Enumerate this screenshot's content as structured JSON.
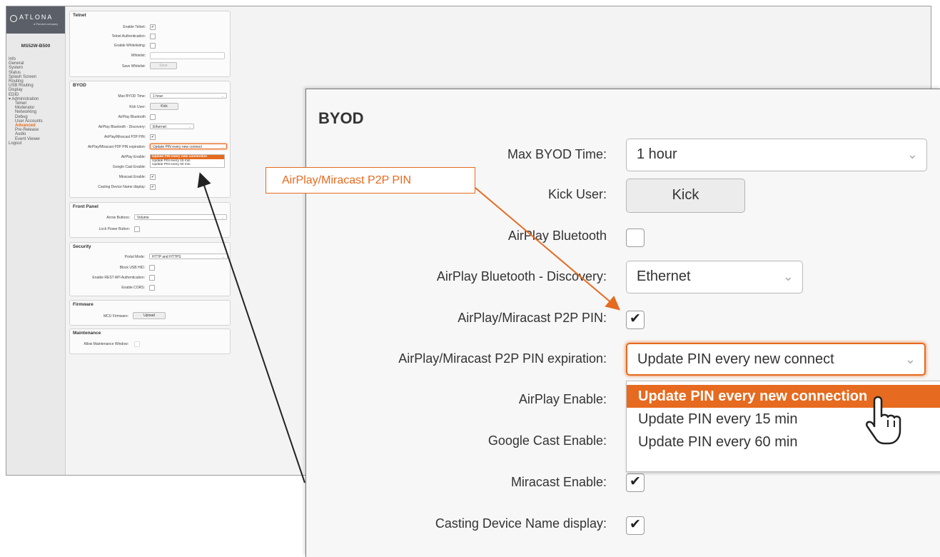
{
  "brand": {
    "logo_text": "ATLONA",
    "logo_sub": "a Panduit company",
    "model": "MS52W-B500"
  },
  "nav": [
    {
      "label": "Info",
      "sub": false,
      "active": false
    },
    {
      "label": "General",
      "sub": false,
      "active": false
    },
    {
      "label": "System",
      "sub": false,
      "active": false
    },
    {
      "label": "Status",
      "sub": false,
      "active": false
    },
    {
      "label": "Splash Screen",
      "sub": false,
      "active": false
    },
    {
      "label": "Routing",
      "sub": false,
      "active": false
    },
    {
      "label": "USB Routing",
      "sub": false,
      "active": false
    },
    {
      "label": "Display",
      "sub": false,
      "active": false
    },
    {
      "label": "EDID",
      "sub": false,
      "active": false
    },
    {
      "label": "▾ Administration",
      "sub": false,
      "active": false
    },
    {
      "label": "Telnet",
      "sub": true,
      "active": false
    },
    {
      "label": "Moderator",
      "sub": true,
      "active": false
    },
    {
      "label": "Networking",
      "sub": true,
      "active": false
    },
    {
      "label": "Debug",
      "sub": true,
      "active": false
    },
    {
      "label": "User Accounts",
      "sub": true,
      "active": false
    },
    {
      "label": "Advanced",
      "sub": true,
      "active": true
    },
    {
      "label": "Pre-Release",
      "sub": true,
      "active": false
    },
    {
      "label": "Audio",
      "sub": true,
      "active": false
    },
    {
      "label": "Event Viewer",
      "sub": true,
      "active": false
    },
    {
      "label": "Logout",
      "sub": false,
      "active": false
    }
  ],
  "telnet": {
    "title": "Telnet",
    "enable_telnet": "Enable Telnet:",
    "telnet_auth": "Telnet Authentication:",
    "enable_whitelisting": "Enable Whitelisting:",
    "whitelist": "Whitelist:",
    "save_whitelist": "Save Whitelist:",
    "save_button": "Save"
  },
  "byod": {
    "title": "BYOD",
    "max_byod_time": "Max BYOD Time:",
    "max_byod_value": "1 hour",
    "kick_user": "Kick User:",
    "kick_button": "Kick",
    "airplay_bluetooth": "AirPlay Bluetooth",
    "airplay_bt_discovery": "AirPlay Bluetooth - Discovery:",
    "discovery_value": "Ethernet",
    "p2p_pin": "AirPlay/Miracast P2P PIN:",
    "p2p_pin_expiration": "AirPlay/Miracast P2P PIN expiration:",
    "expiration_value": "Update PIN every new connect",
    "expiration_value_small": "Update PIN every new connect",
    "expiration_options": [
      "Update PIN every new connection",
      "Update PIN every 15 min",
      "Update PIN every 60 min"
    ],
    "airplay_enable": "AirPlay Enable:",
    "google_cast_enable": "Google Cast Enable:",
    "miracast_enable": "Miracast Enable:",
    "casting_name": "Casting Device Name display:"
  },
  "front_panel": {
    "title": "Front Panel",
    "arrow_buttons": "Arrow Buttons:",
    "arrow_value": "Volume",
    "lock_power": "Lock Power Button:"
  },
  "security": {
    "title": "Security",
    "portal_mode": "Portal Mode:",
    "portal_value": "HTTP and HTTPS",
    "block_usb_hid": "Block USB HID:",
    "rest_api_auth": "Enable REST API Authentication:",
    "enable_cors": "Enable CORS:"
  },
  "firmware": {
    "title": "Firmware",
    "mcu_firmware": "MCU Firmware:",
    "upload_button": "Upload"
  },
  "maintenance": {
    "title": "Maintenance",
    "allow_window": "Allow Maintenance Window:"
  },
  "callout": {
    "text": "AirPlay/Miracast P2P PIN"
  },
  "colors": {
    "accent": "#e66a1f",
    "sidebar_header": "#5b6068"
  }
}
